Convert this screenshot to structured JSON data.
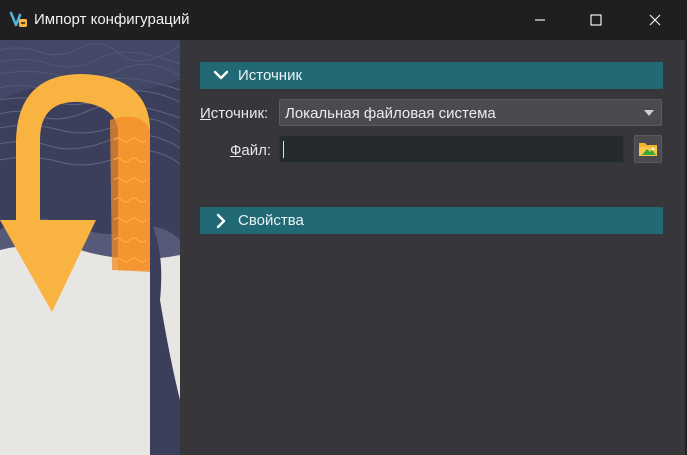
{
  "window": {
    "title": "Импорт конфигураций",
    "minimize_icon": "minimize-icon",
    "maximize_icon": "maximize-icon",
    "close_icon": "close-icon"
  },
  "source_section": {
    "title": "Источник",
    "expanded": true,
    "source_label_underlined": "И",
    "source_label_rest": "сточник:",
    "source_value": "Локальная файловая система",
    "file_label_underlined": "Ф",
    "file_label_rest": "айл:",
    "file_value": "",
    "browse_icon": "folder-icon"
  },
  "properties_section": {
    "title": "Свойства",
    "expanded": false
  },
  "colors": {
    "section_header": "#216a75",
    "dialog_background": "#37373b",
    "titlebar": "#1f1f1f",
    "arrow_orange": "#f9b340"
  }
}
